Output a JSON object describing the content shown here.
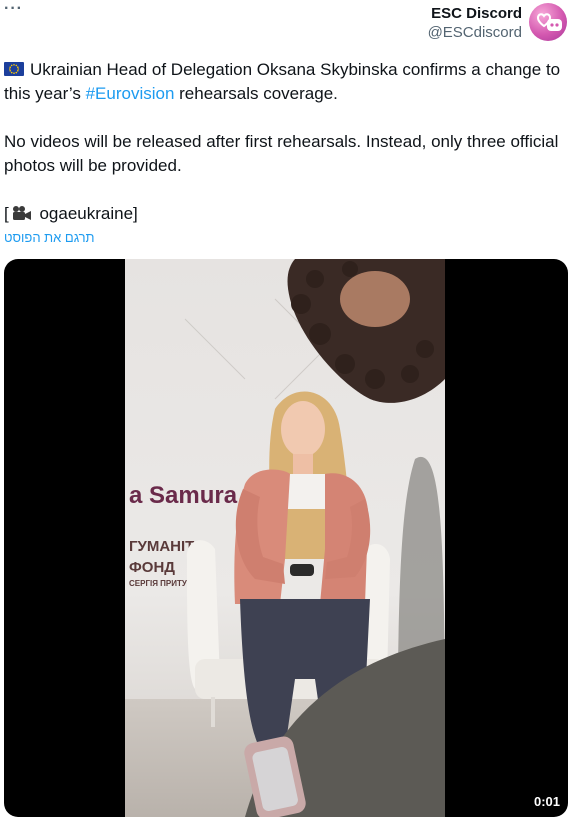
{
  "header": {
    "more_label": "···",
    "display_name": "ESC Discord",
    "handle": "@ESCdiscord"
  },
  "tweet": {
    "line1_main": "Ukrainian Head of Delegation Oksana Skybinska confirms a change to this year’s ",
    "hashtag": "#Eurovision",
    "line1_end": " rehearsals coverage.",
    "paragraph2": "No videos will be released after first rehearsals. Instead, only three official photos will be provided.",
    "credit_open": "[",
    "credit_name": " ogaeukraine]",
    "translate_label": "תרגם את הפוסט"
  },
  "video": {
    "duration": "0:01",
    "backdrop_text_1": "a Samura",
    "backdrop_text_2": "ГУМАНІТ",
    "backdrop_text_3": "ФОНД",
    "backdrop_text_4": "СЕРГІЯ ПРИТУ"
  },
  "colors": {
    "accent": "#1d9bf0",
    "secondary_text": "#536471",
    "avatar": "#d459b0"
  },
  "icons": [
    "more-icon",
    "discord-heart-icon",
    "eu-flag-icon",
    "video-camera-icon"
  ]
}
